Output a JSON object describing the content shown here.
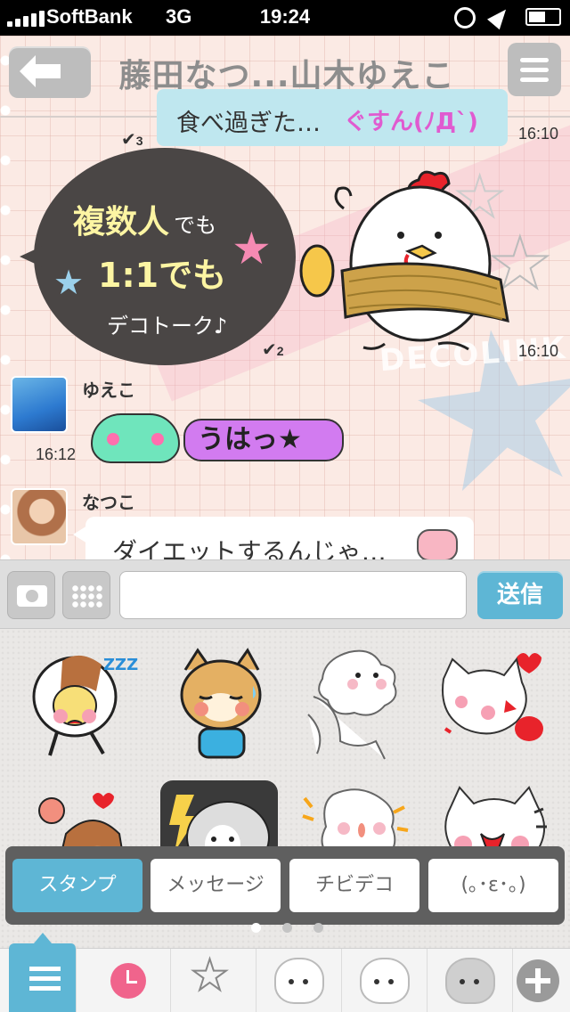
{
  "status_bar": {
    "carrier": "SoftBank",
    "network": "3G",
    "time": "19:24"
  },
  "header": {
    "title": "藤田なつ...山木ゆえこ"
  },
  "messages": [
    {
      "text": "食べ過ぎた…",
      "decoration_text": "ぐすん(ﾉД`)",
      "read_count": "3",
      "time": "16:10"
    },
    {
      "type": "promo-sticker",
      "line1_big": "複数人",
      "line1_small": "でも",
      "line2": "1:1でも",
      "line3": "デコトーク♪",
      "read_count": "2",
      "time": "16:10"
    },
    {
      "sender": "ゆえこ",
      "time": "16:12",
      "sticker_text": "うはっ★"
    },
    {
      "sender": "なつこ",
      "text": "ダイエットするんじゃ…"
    }
  ],
  "background": {
    "logo_text": "DECOLINK"
  },
  "input_bar": {
    "placeholder": "",
    "send_label": "送信"
  },
  "sticker_panel": {
    "categories": [
      "スタンプ",
      "メッセージ",
      "チビデコ",
      "(｡･ε･｡)"
    ],
    "active_category": "スタンプ",
    "page_count": 3,
    "current_page": 1
  },
  "colors": {
    "accent": "#5eb6d5",
    "promo_bubble": "#4a4645",
    "promo_text": "#fdf5a3",
    "clock_pink": "#f0648c"
  }
}
